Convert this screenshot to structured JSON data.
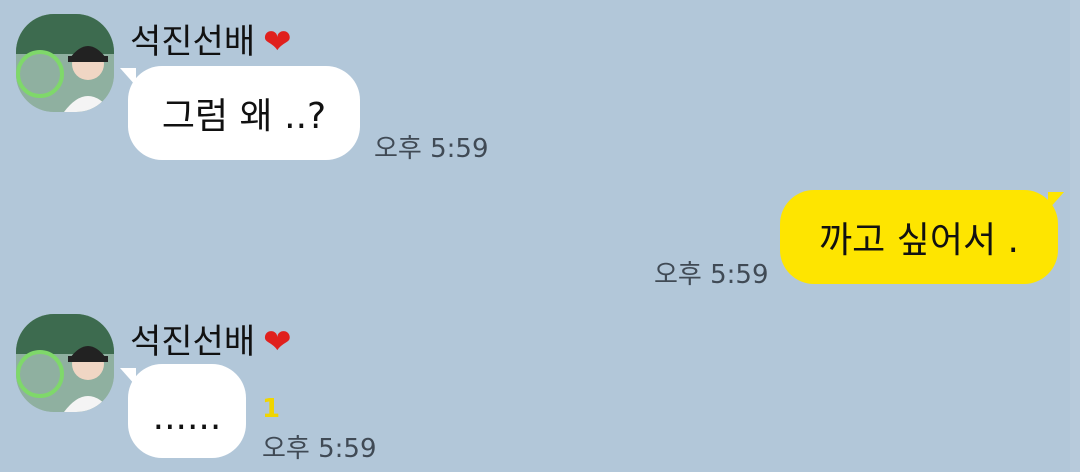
{
  "messages": [
    {
      "sender": "석진선배",
      "heart": "❤",
      "text": "그럼 왜 ..?",
      "time": "오후 5:59",
      "direction": "incoming"
    },
    {
      "text": "까고 싶어서 .",
      "time": "오후 5:59",
      "direction": "outgoing"
    },
    {
      "sender": "석진선배",
      "heart": "❤",
      "text": "......",
      "unread": "1",
      "time": "오후 5:59",
      "direction": "incoming"
    }
  ],
  "colors": {
    "background": "#b2c7d9",
    "incoming_bubble": "#ffffff",
    "outgoing_bubble": "#fee500",
    "heart": "#e0201d",
    "unread": "#f0d500"
  }
}
